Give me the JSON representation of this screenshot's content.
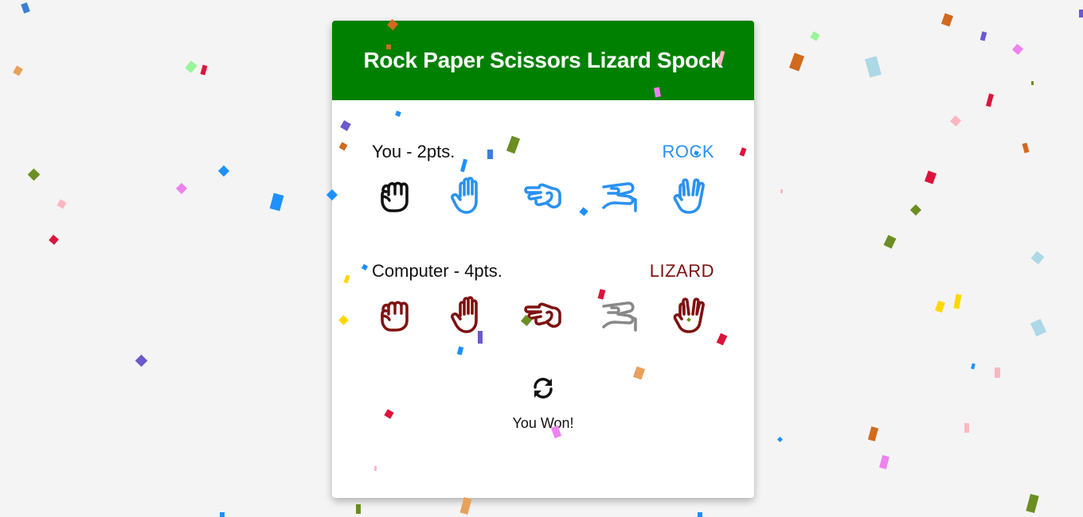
{
  "game": {
    "title": "Rock Paper Scissors Lizard Spock",
    "header_color": "#008000"
  },
  "player": {
    "label": "You - 2pts.",
    "choice": "ROCK",
    "color": "#2b91f0",
    "hands": [
      {
        "name": "rock",
        "icon": "rock-hand-icon",
        "color": "#111111",
        "selected": true
      },
      {
        "name": "paper",
        "icon": "paper-hand-icon",
        "color": "#2b91f0"
      },
      {
        "name": "scissors",
        "icon": "scissors-hand-icon",
        "color": "#2b91f0"
      },
      {
        "name": "lizard",
        "icon": "lizard-hand-icon",
        "color": "#2b91f0"
      },
      {
        "name": "spock",
        "icon": "spock-hand-icon",
        "color": "#2b91f0"
      }
    ]
  },
  "computer": {
    "label": "Computer - 4pts.",
    "choice": "LIZARD",
    "color": "#7f1111",
    "hands": [
      {
        "name": "rock",
        "icon": "rock-hand-icon",
        "color": "#7f1111"
      },
      {
        "name": "paper",
        "icon": "paper-hand-icon",
        "color": "#7f1111"
      },
      {
        "name": "scissors",
        "icon": "scissors-hand-icon",
        "color": "#7f1111"
      },
      {
        "name": "lizard",
        "icon": "lizard-hand-icon",
        "color": "#888888",
        "selected": true
      },
      {
        "name": "spock",
        "icon": "spock-hand-icon",
        "color": "#7f1111"
      }
    ]
  },
  "reset": {
    "icon": "refresh-icon"
  },
  "result": "You Won!",
  "confetti_colors": [
    "#3b7fd4",
    "#e8a15c",
    "#98f598",
    "#dc143c",
    "#6a5acd",
    "#6b8e23",
    "#ffb6c1",
    "#ee82ee",
    "#d2691e",
    "#add8e6",
    "#ffd700",
    "#1e90ff"
  ]
}
